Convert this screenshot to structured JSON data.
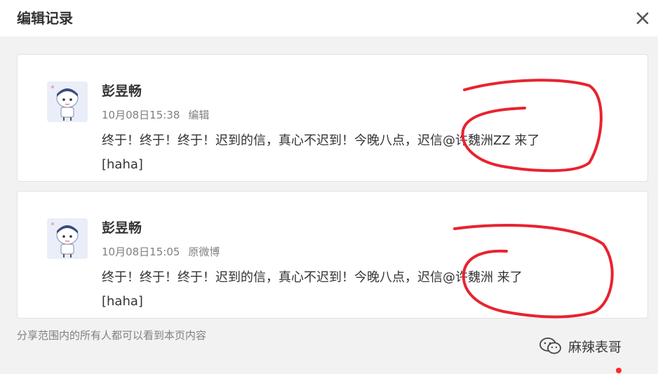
{
  "dialog": {
    "title": "编辑记录",
    "close_icon": "close-icon"
  },
  "records": [
    {
      "user": "彭昱畅",
      "time": "10月08日15:38",
      "tag": "编辑",
      "content_line1": "终于！终于！终于！迟到的信，真心不迟到！今晚八点，迟信@许魏洲ZZ 来了",
      "content_line2": "[haha]"
    },
    {
      "user": "彭昱畅",
      "time": "10月08日15:05",
      "tag": "原微博",
      "content_line1": "终于！终于！终于！迟到的信，真心不迟到！今晚八点，迟信@许魏洲 来了",
      "content_line2": "[haha]"
    }
  ],
  "footer": {
    "note": "分享范围内的所有人都可以看到本页内容"
  },
  "watermark": {
    "text": "麻辣表哥",
    "icon": "wechat-icon"
  },
  "colors": {
    "accent_red": "#e8232f",
    "text_primary": "#333333",
    "text_secondary": "#808080",
    "page_bg": "#f2f2f2"
  }
}
